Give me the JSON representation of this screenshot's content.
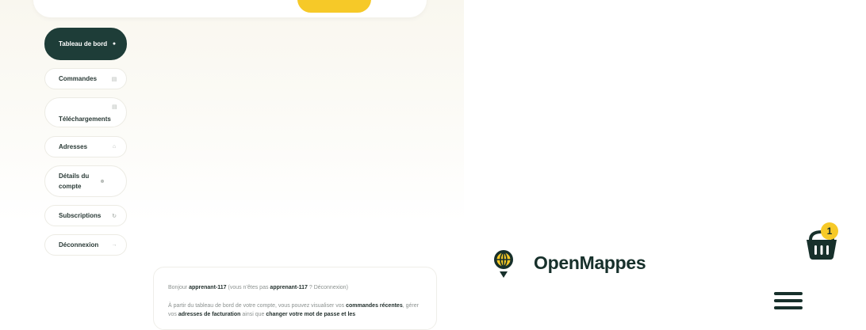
{
  "account_nav": {
    "items": [
      {
        "label": "Tableau de bord",
        "icon": "dashboard-icon",
        "active": true
      },
      {
        "label": "Commandes",
        "icon": "orders-icon"
      },
      {
        "label": "Téléchargements",
        "icon": "downloads-icon"
      },
      {
        "label": "Adresses",
        "icon": "home-icon"
      },
      {
        "label": "Détails du compte",
        "icon": "user-icon"
      },
      {
        "label": "Subscriptions",
        "icon": "refresh-icon"
      },
      {
        "label": "Déconnexion",
        "icon": "logout-icon"
      }
    ]
  },
  "dashboard": {
    "greeting_prefix": "Bonjour ",
    "username": "apprenant-117",
    "greeting_middle": " (vous n’êtes pas ",
    "username_again": "apprenant-117",
    "greeting_sep": " ? ",
    "logout_link": "Déconnexion",
    "greeting_end": ")",
    "intro_prefix": "À partir du tableau de bord de votre compte, vous pouvez visualiser vos ",
    "orders_link": "commandes récentes",
    "intro_mid1": ", gérer vos ",
    "addresses_link": "adresses de facturation",
    "intro_mid2": " ainsi que ",
    "password_link": "changer votre mot de passe et les"
  },
  "header": {
    "brand": "OpenMappes",
    "cart_count": "1"
  },
  "colors": {
    "primary": "#1e3d38",
    "accent": "#f6c928"
  }
}
